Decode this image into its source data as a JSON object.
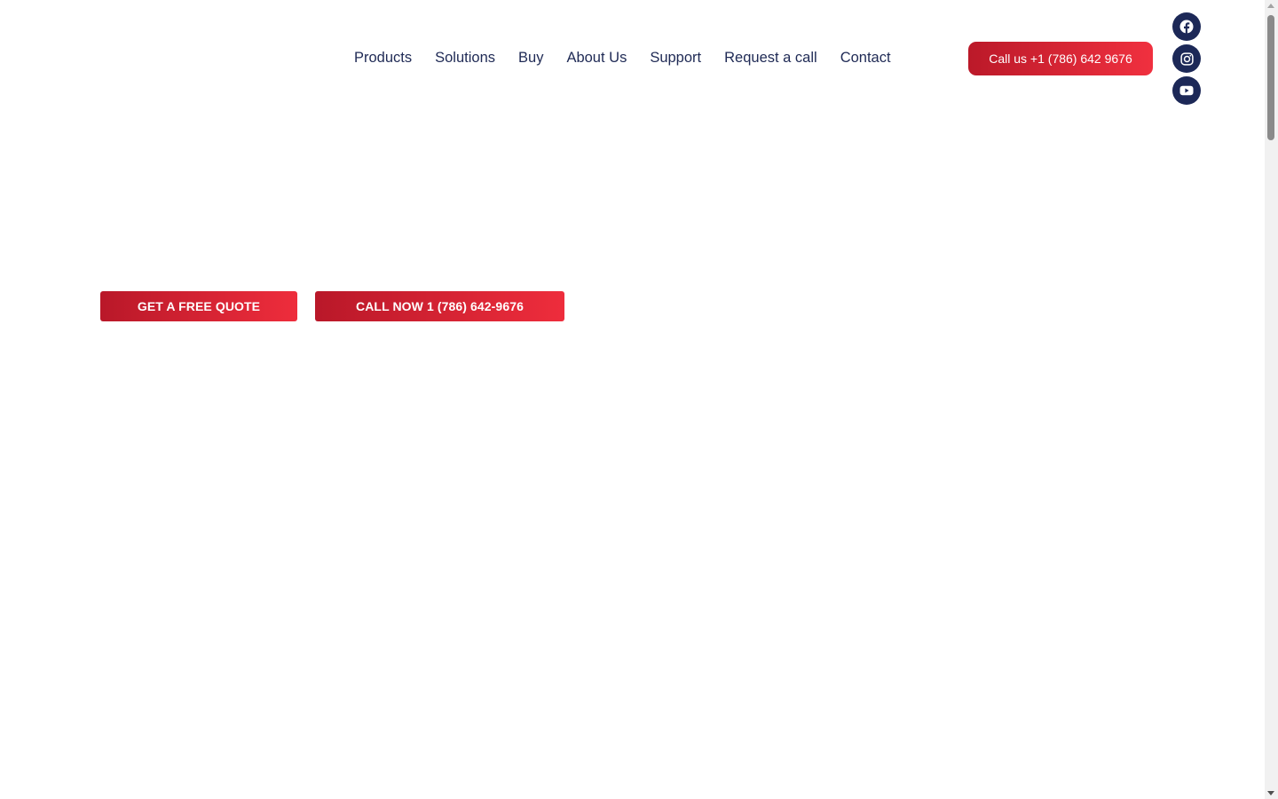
{
  "header": {
    "nav": [
      {
        "label": "Products"
      },
      {
        "label": "Solutions"
      },
      {
        "label": "Buy"
      },
      {
        "label": "About Us"
      },
      {
        "label": "Support"
      },
      {
        "label": "Request a call"
      },
      {
        "label": "Contact"
      }
    ],
    "call_button_label": "Call us +1 (786) 642 9676",
    "social": [
      {
        "icon": "facebook-icon"
      },
      {
        "icon": "instagram-icon"
      },
      {
        "icon": "youtube-icon"
      }
    ]
  },
  "hero": {
    "quote_button_label": "GET A FREE QUOTE",
    "call_now_button_label": "CALL NOW 1 (786) 642-9676"
  },
  "colors": {
    "brand_red": "#d62233",
    "navy": "#1c2857",
    "nav_text": "#1f2a55"
  }
}
